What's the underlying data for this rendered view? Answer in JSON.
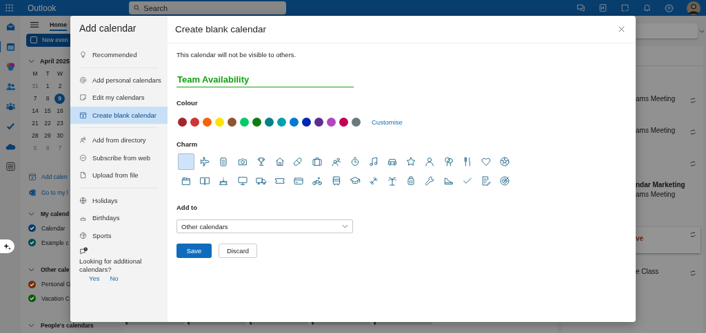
{
  "top_bar": {
    "app_name": "Outlook",
    "search": {
      "placeholder": "Search"
    }
  },
  "left_pane": {
    "tab": "Home",
    "new_event": "New even",
    "mini_calendar": {
      "month": "April 2025",
      "weekdays": [
        "M",
        "T",
        "W"
      ],
      "weeks": [
        [
          {
            "day": "31",
            "in_month": false,
            "selected": false
          },
          {
            "day": "1",
            "in_month": true,
            "selected": false
          },
          {
            "day": "2",
            "in_month": true,
            "selected": false
          }
        ],
        [
          {
            "day": "7",
            "in_month": true,
            "selected": false
          },
          {
            "day": "8",
            "in_month": true,
            "selected": false
          },
          {
            "day": "9",
            "in_month": true,
            "selected": true
          }
        ],
        [
          {
            "day": "14",
            "in_month": true,
            "selected": false
          },
          {
            "day": "15",
            "in_month": true,
            "selected": false
          },
          {
            "day": "16",
            "in_month": true,
            "selected": false
          }
        ],
        [
          {
            "day": "21",
            "in_month": true,
            "selected": false
          },
          {
            "day": "22",
            "in_month": true,
            "selected": false
          },
          {
            "day": "23",
            "in_month": true,
            "selected": false
          }
        ],
        [
          {
            "day": "28",
            "in_month": true,
            "selected": false
          },
          {
            "day": "29",
            "in_month": true,
            "selected": false
          },
          {
            "day": "30",
            "in_month": true,
            "selected": false
          }
        ],
        [
          {
            "day": "5",
            "in_month": false,
            "selected": false
          },
          {
            "day": "6",
            "in_month": false,
            "selected": false
          },
          {
            "day": "7",
            "in_month": false,
            "selected": false
          }
        ]
      ]
    },
    "links": [
      "Add calen",
      "Go to my l"
    ],
    "calendar_groups": [
      {
        "title": "My calend",
        "calendars": [
          {
            "name": "Calendar",
            "color": "#093f6e"
          },
          {
            "name": "Example c",
            "color": "#024c4e"
          }
        ]
      },
      {
        "title": "Other cale",
        "calendars": [
          {
            "name": "Personal G",
            "color": "#752e09"
          },
          {
            "name": "Vacation C",
            "color": "#0b5d08"
          }
        ]
      },
      {
        "title": "People's calendars"
      }
    ]
  },
  "agenda": [
    {
      "title": "ams Meeting",
      "recurring": true,
      "highlighted": false
    },
    {
      "title": "ams Meeting",
      "recurring": true,
      "highlighted": false
    },
    {
      "title": "ndar Marketing",
      "subtitle": "ams Meeting",
      "recurring": true,
      "highlighted": false
    },
    {
      "title": "ve",
      "recurring": true,
      "highlighted": true
    },
    {
      "title": "e Class",
      "recurring": true,
      "highlighted": false
    }
  ],
  "dialog": {
    "sidebar": {
      "title": "Add calendar",
      "groups": [
        [
          {
            "label": "Recommended",
            "selected": false
          }
        ],
        [
          {
            "label": "Add personal calendars",
            "selected": false
          },
          {
            "label": "Edit my calendars",
            "selected": false
          },
          {
            "label": "Create blank calendar",
            "selected": true
          }
        ],
        [
          {
            "label": "Add from directory",
            "selected": false
          },
          {
            "label": "Subscribe from web",
            "selected": false
          },
          {
            "label": "Upload from file",
            "selected": false
          }
        ],
        [
          {
            "label": "Holidays",
            "selected": false
          },
          {
            "label": "Birthdays",
            "selected": false
          },
          {
            "label": "Sports",
            "selected": false
          }
        ]
      ],
      "feedback": {
        "text": "Looking for additional calendars?",
        "yes": "Yes",
        "no": "No"
      }
    },
    "form": {
      "title": "Create blank calendar",
      "note": "This calendar will not be visible to others.",
      "name_value": "Team Availability",
      "colour_label": "Colour",
      "colours": [
        {
          "color": "#a4262c"
        },
        {
          "color": "#d13438"
        },
        {
          "color": "#f7630c"
        },
        {
          "color": "#fde300"
        },
        {
          "color": "#8e562e"
        },
        {
          "color": "#00cc6a"
        },
        {
          "color": "#107c10"
        },
        {
          "color": "#038387"
        },
        {
          "color": "#00a2ad"
        },
        {
          "color": "#0078d4"
        },
        {
          "color": "#0027b4"
        },
        {
          "color": "#5c2e91"
        },
        {
          "color": "#b146c2"
        },
        {
          "color": "#c30052"
        },
        {
          "color": "#69797e"
        }
      ],
      "customise": "Customise",
      "charm_label": "Charm",
      "charms": [
        {
          "selected": true
        },
        {
          "selected": false
        },
        {
          "selected": false
        },
        {
          "selected": false
        },
        {
          "selected": false
        },
        {
          "selected": false
        },
        {
          "selected": false
        },
        {
          "selected": false
        },
        {
          "selected": false
        },
        {
          "selected": false
        },
        {
          "selected": false
        },
        {
          "selected": false
        },
        {
          "selected": false
        },
        {
          "selected": false
        },
        {
          "selected": false
        },
        {
          "selected": false
        },
        {
          "selected": false
        },
        {
          "selected": false
        },
        {
          "selected": false
        },
        {
          "selected": false
        },
        {
          "selected": false
        },
        {
          "selected": false
        },
        {
          "selected": false
        },
        {
          "selected": false
        },
        {
          "selected": false
        },
        {
          "selected": false
        },
        {
          "selected": false
        },
        {
          "selected": false
        },
        {
          "selected": false
        },
        {
          "selected": false
        },
        {
          "selected": false
        },
        {
          "selected": false
        },
        {
          "selected": false
        },
        {
          "selected": false
        },
        {
          "selected": false
        },
        {
          "selected": false
        }
      ],
      "add_to_label": "Add to",
      "add_to_value": "Other calendars",
      "save": "Save",
      "discard": "Discard"
    }
  }
}
